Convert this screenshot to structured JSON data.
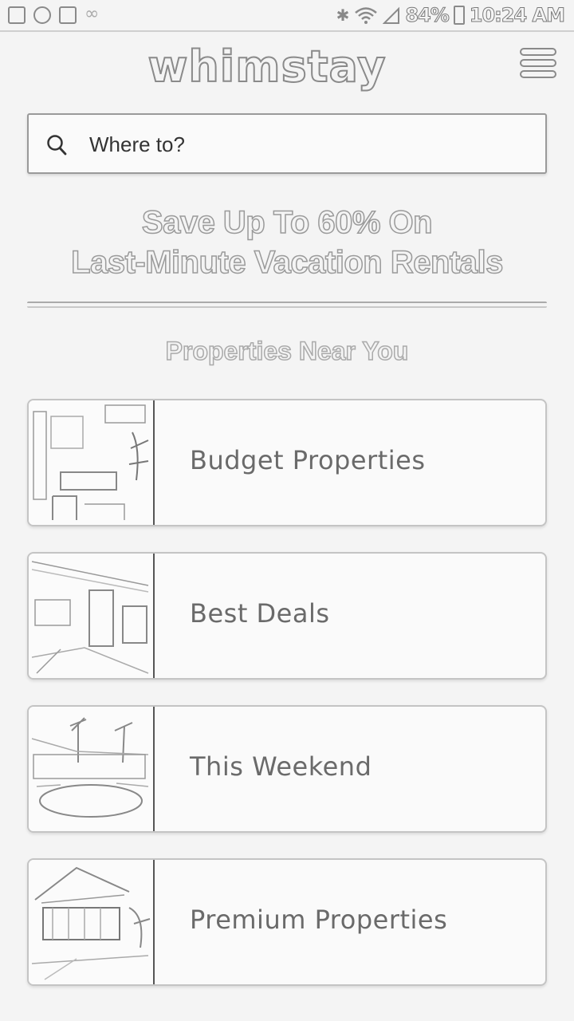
{
  "status_bar": {
    "battery": "84%",
    "time": "10:24 AM"
  },
  "header": {
    "logo": "whimstay"
  },
  "search": {
    "placeholder": "Where to?"
  },
  "hero": {
    "line1": "Save Up To 60% On",
    "line2": "Last-Minute Vacation Rentals"
  },
  "section": {
    "title": "Properties Near You"
  },
  "categories": [
    {
      "label": "Budget Properties",
      "image": "living-room-image"
    },
    {
      "label": "Best Deals",
      "image": "interior-image"
    },
    {
      "label": "This Weekend",
      "image": "resort-pool-image"
    },
    {
      "label": "Premium Properties",
      "image": "house-exterior-image"
    }
  ]
}
